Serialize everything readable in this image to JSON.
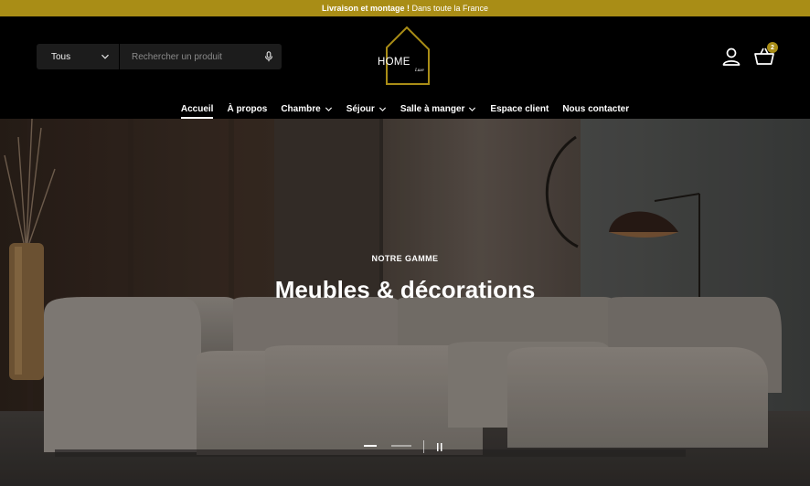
{
  "announcement": {
    "bold": "Livraison et montage !",
    "rest": "Dans toute la France"
  },
  "search": {
    "category": "Tous",
    "placeholder": "Rechercher un produit"
  },
  "logo": {
    "main": "HOME",
    "sub": "Luxe"
  },
  "cart": {
    "count": "2"
  },
  "nav": {
    "items": [
      {
        "label": "Accueil"
      },
      {
        "label": "À propos"
      },
      {
        "label": "Chambre"
      },
      {
        "label": "Séjour"
      },
      {
        "label": "Salle à manger"
      },
      {
        "label": "Espace client"
      },
      {
        "label": "Nous contacter"
      }
    ]
  },
  "hero": {
    "eyebrow": "NOTRE GAMME",
    "title": "Meubles & décorations"
  },
  "colors": {
    "accent": "#a98d16",
    "background": "#000000"
  },
  "icons": [
    "chevron-down-icon",
    "microphone-icon",
    "user-icon",
    "basket-icon",
    "pause-icon"
  ]
}
